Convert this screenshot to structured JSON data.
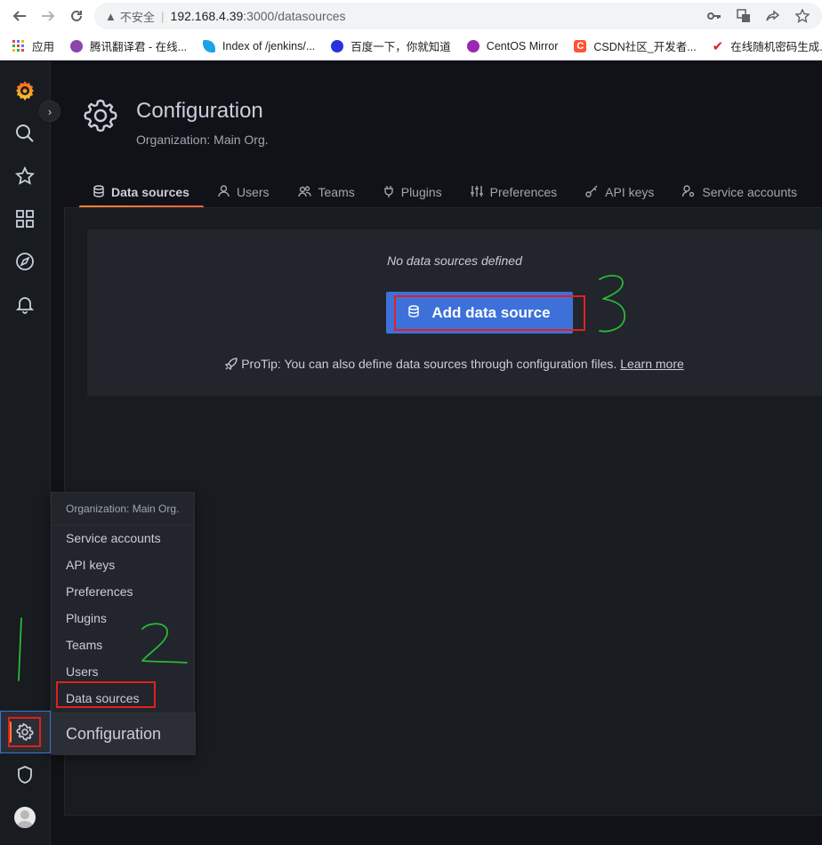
{
  "browser": {
    "url_warning": "不安全",
    "url_host": "192.168.4.39",
    "url_path": ":3000/datasources",
    "bookmarks": [
      {
        "label": "应用",
        "color": "#e8453c"
      },
      {
        "label": "腾讯翻译君 - 在线...",
        "color": "#8e44ad"
      },
      {
        "label": "Index of /jenkins/...",
        "color": "#1aa3e8"
      },
      {
        "label": "百度一下，你就知道",
        "color": "#2932e1"
      },
      {
        "label": "CentOS Mirror",
        "color": "#9c27b0"
      },
      {
        "label": "CSDN社区_开发者...",
        "color": "#fc5531"
      },
      {
        "label": "在线随机密码生成...",
        "color": "#e02020"
      }
    ]
  },
  "header": {
    "title": "Configuration",
    "subtitle": "Organization: Main Org."
  },
  "tabs": [
    {
      "label": "Data sources",
      "icon": "database-icon",
      "active": true
    },
    {
      "label": "Users",
      "icon": "user-icon",
      "active": false
    },
    {
      "label": "Teams",
      "icon": "users-icon",
      "active": false
    },
    {
      "label": "Plugins",
      "icon": "plug-icon",
      "active": false
    },
    {
      "label": "Preferences",
      "icon": "sliders-icon",
      "active": false
    },
    {
      "label": "API keys",
      "icon": "key-icon",
      "active": false
    },
    {
      "label": "Service accounts",
      "icon": "user-cog-icon",
      "active": false
    }
  ],
  "empty_state": {
    "title": "No data sources defined",
    "button_label": "Add data source",
    "protip_text": "ProTip: You can also define data sources through configuration files.",
    "learn_more": "Learn more"
  },
  "flyout": {
    "header": "Organization: Main Org.",
    "items": [
      "Service accounts",
      "API keys",
      "Preferences",
      "Plugins",
      "Teams",
      "Users",
      "Data sources"
    ],
    "footer": "Configuration"
  },
  "annotations": {
    "mark_1": "1",
    "mark_2": "2",
    "mark_3": "3",
    "color": "#2bb83a"
  },
  "colors": {
    "accent_blue": "#3d71d9",
    "accent_orange": "#ff7d3b",
    "highlight_red": "#e02020"
  }
}
